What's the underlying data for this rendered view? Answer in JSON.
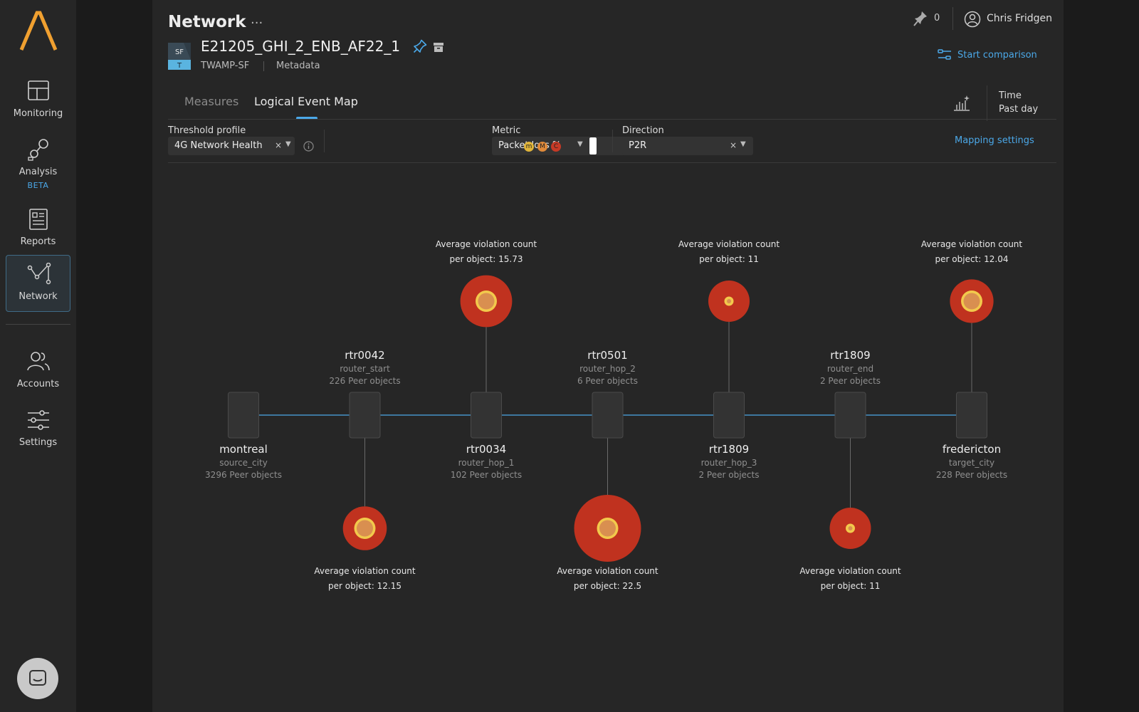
{
  "sidebar": {
    "items": [
      {
        "label": "Monitoring",
        "icon": "monitoring-icon"
      },
      {
        "label": "Analysis",
        "sub": "BETA",
        "icon": "analysis-icon"
      },
      {
        "label": "Reports",
        "icon": "reports-icon"
      },
      {
        "label": "Network",
        "icon": "network-icon",
        "active": true
      },
      {
        "label": "Accounts",
        "icon": "accounts-icon"
      },
      {
        "label": "Settings",
        "icon": "settings-icon"
      }
    ]
  },
  "header": {
    "title": "Network",
    "menu": "···",
    "pin_count": "0",
    "user_name": "Chris Fridgen"
  },
  "device": {
    "badge_top": "SF",
    "badge_bottom": "T",
    "name": "E21205_GHI_2_ENB_AF22_1",
    "type": "TWAMP-SF",
    "metadata_link": "Metadata",
    "compare_label": "Start comparison"
  },
  "tabs": [
    {
      "label": "Measures",
      "active": false
    },
    {
      "label": "Logical Event Map",
      "active": true
    }
  ],
  "time": {
    "label": "Time",
    "value": "Past day"
  },
  "filters": {
    "threshold": {
      "label": "Threshold profile",
      "value": "4G Network Health",
      "clear": "×"
    },
    "metric": {
      "label": "Metric",
      "value": "Packet loss %",
      "severities": [
        "m",
        "M",
        "C"
      ]
    },
    "direction": {
      "label": "Direction",
      "value": "P2R",
      "clear": "×"
    },
    "mapping_link": "Mapping settings"
  },
  "colors": {
    "accent": "#4ba8e8",
    "violation_outer": "#c0321f",
    "violation_ring": "#f2c94c",
    "violation_core": "#d98f50",
    "node_fill": "#333333"
  },
  "map": {
    "violation_caption_line1": "Average violation count",
    "nodes": [
      {
        "name": "montreal",
        "role": "source_city",
        "peers": "3296 Peer objects",
        "label_pos": "below",
        "violation": null
      },
      {
        "name": "rtr0042",
        "role": "router_start",
        "peers": "226 Peer objects",
        "label_pos": "above",
        "violation": {
          "value": "12.15",
          "caption": "per object: 12.15",
          "pos": "below"
        }
      },
      {
        "name": "rtr0034",
        "role": "router_hop_1",
        "peers": "102 Peer objects",
        "label_pos": "below",
        "violation": {
          "value": "15.73",
          "caption": "per object: 15.73",
          "pos": "above"
        }
      },
      {
        "name": "rtr0501",
        "role": "router_hop_2",
        "peers": "6 Peer objects",
        "label_pos": "above",
        "violation": {
          "value": "22.5",
          "caption": "per object: 22.5",
          "pos": "below"
        }
      },
      {
        "name": "rtr1809",
        "role": "router_hop_3",
        "peers": "2 Peer objects",
        "label_pos": "below",
        "violation": {
          "value": "11",
          "caption": "per object: 11",
          "pos": "above"
        }
      },
      {
        "name": "rtr1809",
        "role": "router_end",
        "peers": "2 Peer objects",
        "label_pos": "above",
        "violation": {
          "value": "11",
          "caption": "per object: 11",
          "pos": "below"
        }
      },
      {
        "name": "fredericton",
        "role": "target_city",
        "peers": "228 Peer objects",
        "label_pos": "below",
        "violation": {
          "value": "12.04",
          "caption": "per object: 12.04",
          "pos": "above"
        }
      }
    ]
  }
}
